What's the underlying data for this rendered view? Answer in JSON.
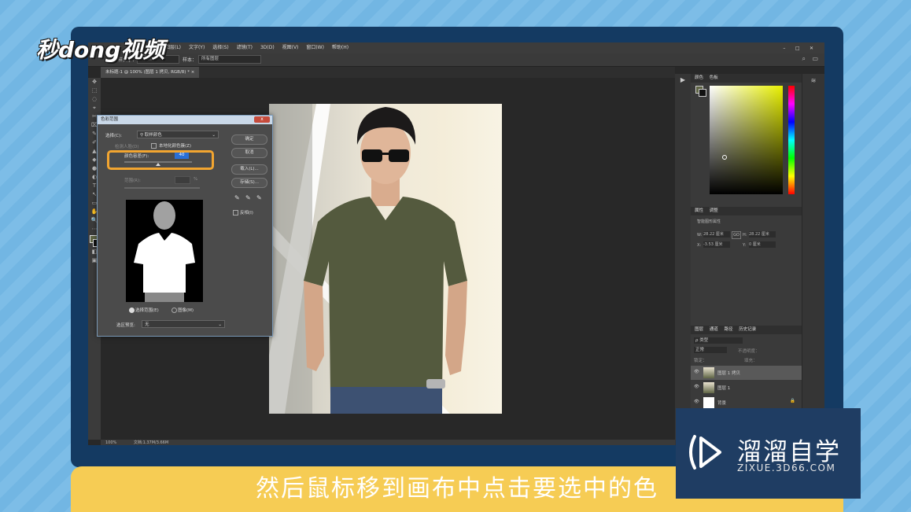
{
  "logo": {
    "text": "秒dong视频"
  },
  "caption": "然后鼠标移到画布中点击要选中的色",
  "colors": {
    "frame": "#143a62",
    "caption_bar": "#f6cc54",
    "highlight": "#f2a530",
    "watermark_bg": "#1f3d63"
  },
  "ps": {
    "menu": [
      "图层(L)",
      "文字(Y)",
      "选择(S)",
      "滤镜(T)",
      "3D(D)",
      "视图(V)",
      "窗口(W)",
      "帮助(H)"
    ],
    "options": {
      "sample_size_label": "取样大小：",
      "sample_size_value": "取样点",
      "sample_label": "样本：",
      "sample_value": "所有图层"
    },
    "doc_tab": "未标题-1 @ 100% (图层 1 拷贝, RGB/8) *",
    "tools": [
      "✥",
      "⬚",
      "◌",
      "⌖",
      "✂",
      "⌧",
      "✎",
      "✐",
      "▲",
      "◆",
      "●",
      "◐",
      "T",
      "↖",
      "▭",
      "✋",
      "🔍",
      "⋯",
      "◧",
      "▣"
    ],
    "status": {
      "zoom": "100%",
      "doc": "文档:1.37M/3.66M"
    },
    "color_panel": {
      "tabs": [
        "颜色",
        "色板"
      ]
    },
    "props_panel": {
      "tabs": [
        "属性",
        "调整"
      ],
      "title": "智能图形属性",
      "w_label": "W:",
      "w_value": "28.22 厘米",
      "link": "GO",
      "h_label": "H:",
      "h_value": "28.22 厘米",
      "x_label": "X:",
      "x_value": "-3.53 厘米",
      "y_label": "Y:",
      "y_value": "0 厘米"
    },
    "layers_panel": {
      "tabs": [
        "图层",
        "通道",
        "路径",
        "历史记录"
      ],
      "kind": "ρ 类型",
      "blend": "正常",
      "opacity_label": "不透明度：",
      "lock_label": "锁定：",
      "fill_label": "填充：",
      "layers": [
        {
          "name": "图层 1 拷贝",
          "selected": true
        },
        {
          "name": "图层 1",
          "selected": false
        },
        {
          "name": "背景",
          "selected": false
        }
      ]
    },
    "dialog": {
      "title": "色彩范围",
      "close": "x",
      "select_label": "选择(C):",
      "select_value": "取样颜色",
      "detect_faces": "检测人脸(D)",
      "localized": "本地化颜色簇(Z)",
      "fuzziness_label": "颜色容差(F):",
      "fuzziness_value": "40",
      "range_label": "范围(R):",
      "range_unit": "%",
      "ok": "确定",
      "cancel": "取消",
      "load": "载入(L)...",
      "save": "存储(S)...",
      "invert": "反相(I)",
      "radio_selection": "选择范围(E)",
      "radio_image": "图像(M)",
      "preview_label": "选区预览:",
      "preview_value": "无"
    }
  },
  "watermark": {
    "brand": "溜溜自学",
    "url": "ZIXUE.3D66.COM"
  }
}
